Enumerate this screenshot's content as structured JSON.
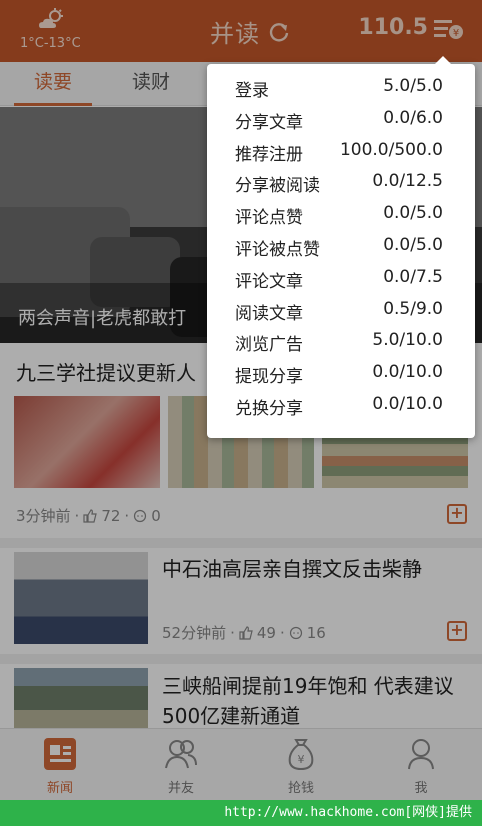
{
  "header": {
    "temperature": "1°C-13°C",
    "title": "并读",
    "score": "110.5",
    "weather_icon": "partly-sunny-icon",
    "refresh_icon": "refresh-icon",
    "menu_icon": "coin-menu-icon"
  },
  "tabs": [
    {
      "label": "读要",
      "active": true
    },
    {
      "label": "读财",
      "active": false
    }
  ],
  "hero": {
    "caption": "两会声音|老虎都敢打"
  },
  "articles": [
    {
      "title": "九三学社提议更新人",
      "time": "3分钟前",
      "likes": "72",
      "comments": "0"
    },
    {
      "title": "中石油高层亲自撰文反击柴静",
      "time": "52分钟前",
      "likes": "49",
      "comments": "16"
    },
    {
      "title": "三峡船闸提前19年饱和 代表建议500亿建新通道"
    }
  ],
  "meta_separator": "·",
  "popup": {
    "rows": [
      {
        "label": "登录",
        "value": "5.0/5.0"
      },
      {
        "label": "分享文章",
        "value": "0.0/6.0"
      },
      {
        "label": "推荐注册",
        "value": "100.0/500.0"
      },
      {
        "label": "分享被阅读",
        "value": "0.0/12.5"
      },
      {
        "label": "评论点赞",
        "value": "0.0/5.0"
      },
      {
        "label": "评论被点赞",
        "value": "0.0/5.0"
      },
      {
        "label": "评论文章",
        "value": "0.0/7.5"
      },
      {
        "label": "阅读文章",
        "value": "0.5/9.0"
      },
      {
        "label": "浏览广告",
        "value": "5.0/10.0"
      },
      {
        "label": "提现分享",
        "value": "0.0/10.0"
      },
      {
        "label": "兑换分享",
        "value": "0.0/10.0"
      }
    ]
  },
  "bottom_nav": [
    {
      "label": "新闻",
      "icon": "news-icon",
      "active": true
    },
    {
      "label": "并友",
      "icon": "friends-icon",
      "active": false
    },
    {
      "label": "抢钱",
      "icon": "money-bag-icon",
      "active": false
    },
    {
      "label": "我",
      "icon": "user-icon",
      "active": false
    }
  ],
  "watermark": "http://www.hackhome.com[网侠]提供",
  "colors": {
    "brand": "#c4582a",
    "accent": "#d2693a",
    "watermark_bg": "#2eb24a"
  }
}
